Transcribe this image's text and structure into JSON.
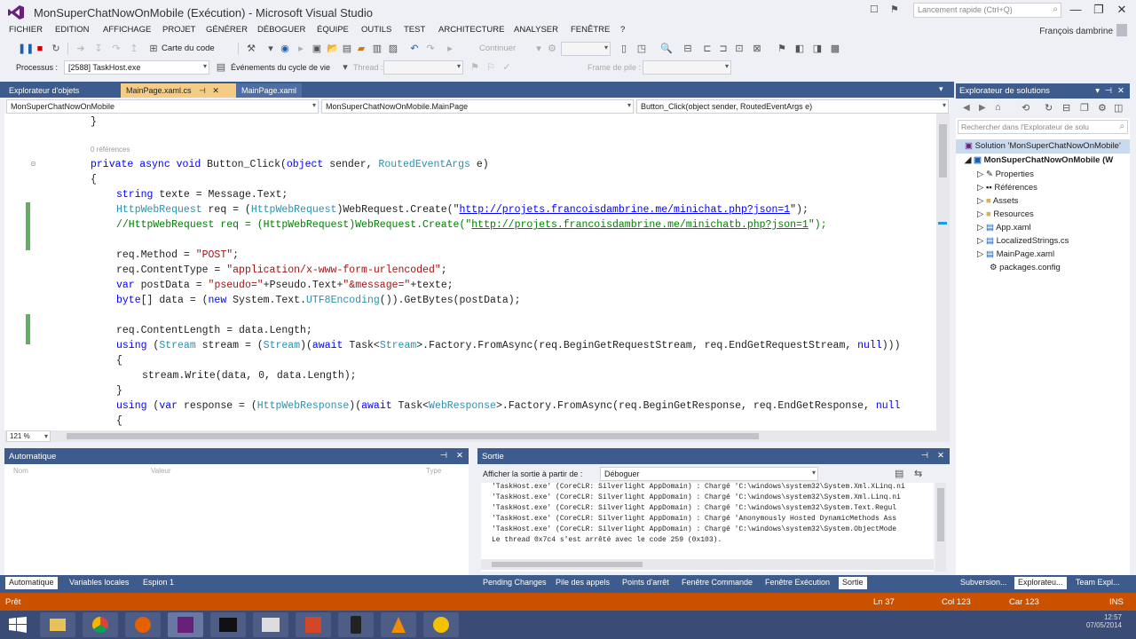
{
  "window": {
    "title": "MonSuperChatNowOnMobile (Exécution) - Microsoft Visual Studio",
    "quick_launch_placeholder": "Lancement rapide (Ctrl+Q)",
    "user": "François dambrine"
  },
  "menu": [
    "FICHIER",
    "EDITION",
    "AFFICHAGE",
    "PROJET",
    "GÉNÉRER",
    "DÉBOGUER",
    "ÉQUIPE",
    "OUTILS",
    "TEST",
    "ARCHITECTURE",
    "ANALYSER",
    "FENÊTRE",
    "?"
  ],
  "toolbar": {
    "code_map": "Carte du code",
    "continue": "Continuer",
    "process_label": "Processus :",
    "process_value": "[2588] TaskHost.exe",
    "lifecycle": "Événements du cycle de vie",
    "thread": "Thread :",
    "stack_frame": "Frame de pile :"
  },
  "doc_tabs": [
    "Explorateur d'objets",
    "MainPage.xaml.cs",
    "MainPage.xaml"
  ],
  "navbar": {
    "project": "MonSuperChatNowOnMobile",
    "class": "MonSuperChatNowOnMobile.MainPage",
    "member": "Button_Click(object sender, RoutedEventArgs e)"
  },
  "editor": {
    "references": "0 références",
    "zoom": "121 %",
    "code": {
      "l_brace_close": "}",
      "signature": [
        "private",
        " ",
        "async",
        " ",
        "void",
        " Button_Click(",
        "object",
        " sender, ",
        "RoutedEventArgs",
        " e)"
      ],
      "brace_open": "{",
      "l1": [
        "string",
        " texte = Message.Text;"
      ],
      "l2_type": "HttpWebRequest",
      "l2_mid": " req = (",
      "l2_cast": "HttpWebRequest",
      "l2_after": ")WebRequest.Create(\"",
      "l2_url": "http://projets.francoisdambrine.me/minichat.php?json=1",
      "l2_end": "\");",
      "l3": "//HttpWebRequest req = (HttpWebRequest)WebRequest.Create(\"",
      "l3_url": "http://projets.francoisdambrine.me/minichatb.php?json=1",
      "l3_end": "\");",
      "l4_a": "req.Method = ",
      "l4_b": "\"POST\"",
      "l4_c": ";",
      "l5_a": "req.ContentType = ",
      "l5_b": "\"application/x-www-form-urlencoded\"",
      "l5_c": ";",
      "l6_a": "var",
      "l6_b": " postData = ",
      "l6_c": "\"pseudo=\"",
      "l6_d": "+Pseudo.Text+",
      "l6_e": "\"&message=\"",
      "l6_f": "+texte;",
      "l7_a": "byte",
      "l7_b": "[] data = (",
      "l7_c": "new",
      "l7_d": " System.Text.",
      "l7_e": "UTF8Encoding",
      "l7_f": "()).GetBytes(postData);",
      "l8": "req.ContentLength = data.Length;",
      "l9_a": "using",
      "l9_b": " (",
      "l9_c": "Stream",
      "l9_d": " stream = (",
      "l9_e": "Stream",
      "l9_f": ")(",
      "l9_g": "await",
      "l9_h": " Task<",
      "l9_i": "Stream",
      "l9_j": ">.Factory.FromAsync(req.BeginGetRequestStream, req.EndGetRequestStream, ",
      "l9_k": "null",
      "l9_l": ")))",
      "l10": "{",
      "l11": "stream.Write(data, 0, data.Length);",
      "l12": "}",
      "l13_a": "using",
      "l13_b": " (",
      "l13_c": "var",
      "l13_d": " response = (",
      "l13_e": "HttpWebResponse",
      "l13_f": ")(",
      "l13_g": "await",
      "l13_h": " Task<",
      "l13_i": "WebResponse",
      "l13_j": ">.Factory.FromAsync(req.BeginGetResponse, req.EndGetResponse, ",
      "l13_k": "null",
      "l14": "{"
    }
  },
  "auto_panel": {
    "title": "Automatique",
    "cols": [
      "Nom",
      "Valeur",
      "Type"
    ],
    "tabs": [
      "Automatique",
      "Variables locales",
      "Espion 1"
    ]
  },
  "output_panel": {
    "title": "Sortie",
    "show_from_label": "Afficher la sortie à partir de :",
    "show_from_value": "Déboguer",
    "lines": [
      "'TaskHost.exe' (CoreCLR: Silverlight AppDomain) : Chargé 'C:\\windows\\system32\\System.Xml.XLinq.ni",
      "'TaskHost.exe' (CoreCLR: Silverlight AppDomain) : Chargé 'C:\\windows\\system32\\System.Xml.Linq.ni",
      "'TaskHost.exe' (CoreCLR: Silverlight AppDomain) : Chargé 'C:\\windows\\system32\\System.Text.Regul",
      "'TaskHost.exe' (CoreCLR: Silverlight AppDomain) : Chargé 'Anonymously Hosted DynamicMethods Ass",
      "'TaskHost.exe' (CoreCLR: Silverlight AppDomain) : Chargé 'C:\\windows\\system32\\System.ObjectMode",
      "Le thread 0x7c4 s'est arrêté avec le code 259 (0x103)."
    ],
    "tabs": [
      "Pending Changes",
      "Pile des appels",
      "Points d'arrêt",
      "Fenêtre Commande",
      "Fenêtre Exécution",
      "Sortie"
    ]
  },
  "solution_explorer": {
    "title": "Explorateur de solutions",
    "search_placeholder": "Rechercher dans l'Explorateur de solu",
    "solution": "Solution 'MonSuperChatNowOnMobile'",
    "project": "MonSuperChatNowOnMobile (W",
    "items": [
      "Properties",
      "Références",
      "Assets",
      "Resources",
      "App.xaml",
      "LocalizedStrings.cs",
      "MainPage.xaml",
      "packages.config"
    ],
    "tabs": [
      "Subversion...",
      "Explorateu...",
      "Team Expl..."
    ]
  },
  "status": {
    "ready": "Prêt",
    "line": "Ln 37",
    "col": "Col 123",
    "char": "Car 123",
    "mode": "INS"
  },
  "clock": {
    "time": "12:57",
    "date": "07/05/2014"
  },
  "colors": {
    "accent": "#3d5b8d",
    "status": "#ca5100",
    "taskbar": "#3a4b75"
  }
}
